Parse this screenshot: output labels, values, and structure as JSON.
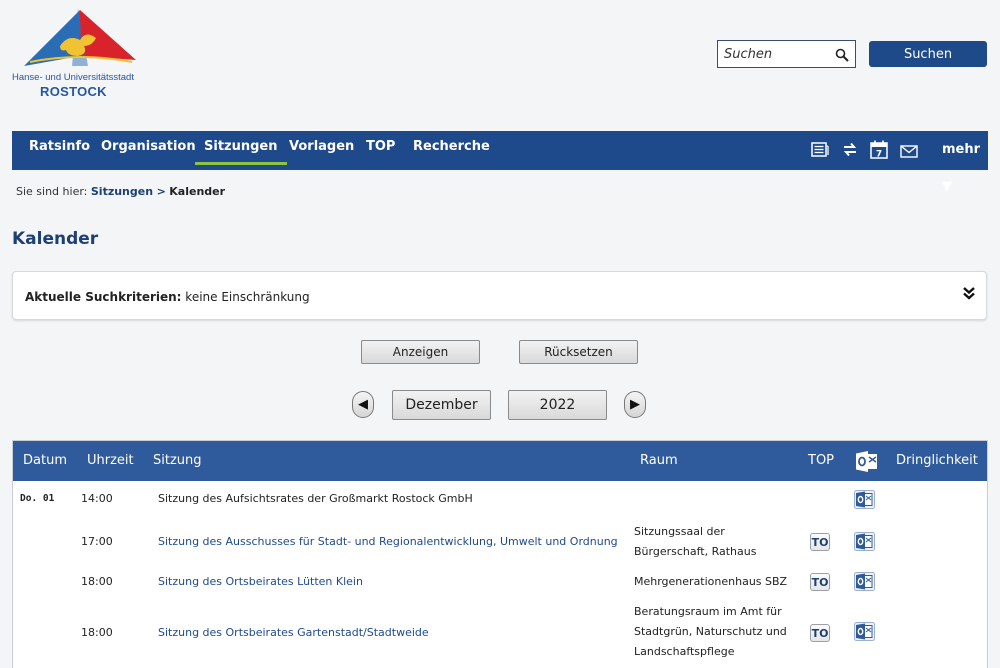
{
  "logo": {
    "line1": "Hanse- und Universitätsstadt",
    "line2": "ROSTOCK"
  },
  "search": {
    "placeholder": "Suchen",
    "button_label": "Suchen"
  },
  "nav": {
    "items": [
      {
        "label": "Ratsinfo"
      },
      {
        "label": "Organisation"
      },
      {
        "label": "Sitzungen"
      },
      {
        "label": "Vorlagen"
      },
      {
        "label": "TOP"
      },
      {
        "label": "Recherche"
      }
    ],
    "active": "Sitzungen",
    "more_label": "mehr ▼",
    "icons": [
      "newspaper-icon",
      "sync-icon",
      "calendar-icon",
      "mail-icon"
    ],
    "calendar_icon_text": "7"
  },
  "breadcrumb": {
    "prefix": "Sie sind hier:",
    "link": "Sitzungen",
    "separator": ">",
    "current": "Kalender"
  },
  "page_title": "Kalender",
  "criteria": {
    "label": "Aktuelle Suchkriterien:",
    "value": "keine Einschränkung",
    "toggle": "⌄⌄"
  },
  "buttons": {
    "show": "Anzeigen",
    "reset": "Rücksetzen"
  },
  "period": {
    "month": "Dezember",
    "year": "2022",
    "prev": "◀",
    "next": "▶"
  },
  "table": {
    "headers": {
      "datum": "Datum",
      "uhrzeit": "Uhrzeit",
      "sitzung": "Sitzung",
      "raum": "Raum",
      "top": "TOP",
      "dringlichkeit": "Dringlichkeit"
    },
    "rows": [
      {
        "datum": "Do. 01",
        "uhrzeit": "14:00",
        "sitzung": "Sitzung des Aufsichtsrates der Großmarkt Rostock GmbH",
        "link": false,
        "raum": "",
        "top": ""
      },
      {
        "datum": "",
        "uhrzeit": "17:00",
        "sitzung": "Sitzung des Ausschusses für Stadt- und Regionalentwicklung, Umwelt und Ordnung",
        "link": true,
        "raum": "Sitzungssaal der Bürgerschaft, Rathaus",
        "top": "TO"
      },
      {
        "datum": "",
        "uhrzeit": "18:00",
        "sitzung": "Sitzung des Ortsbeirates Lütten Klein",
        "link": true,
        "raum": "Mehrgenerationenhaus SBZ",
        "top": "TO"
      },
      {
        "datum": "",
        "uhrzeit": "18:00",
        "sitzung": "Sitzung des Ortsbeirates Gartenstadt/Stadtweide",
        "link": true,
        "raum": "Beratungsraum im Amt für Stadtgrün, Naturschutz und Landschaftspflege",
        "top": "TO"
      }
    ]
  },
  "colors": {
    "nav_bg": "#1e4a8c",
    "active_underline": "#8cc63f",
    "table_header": "#2f5b9c",
    "link": "#1e4a8c"
  }
}
